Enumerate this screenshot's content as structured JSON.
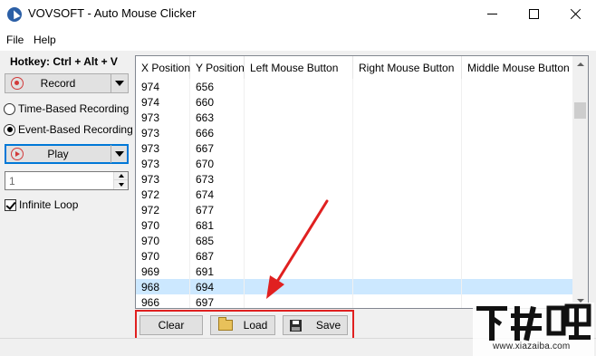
{
  "window": {
    "title": "VOVSOFT - Auto Mouse Clicker",
    "icon": "app-cursor-icon"
  },
  "menu": {
    "file": "File",
    "help": "Help"
  },
  "left_panel": {
    "hotkey": "Hotkey: Ctrl + Alt + V",
    "record_label": "Record",
    "time_based_label": "Time-Based Recording",
    "event_based_label": "Event-Based Recording",
    "selected_mode": "Event-Based Recording",
    "play_label": "Play",
    "repeat_count": "1",
    "infinite_loop_label": "Infinite Loop",
    "infinite_loop_checked": true
  },
  "table": {
    "columns": [
      "X Position",
      "Y Position",
      "Left Mouse Button",
      "Right Mouse Button",
      "Middle Mouse Button"
    ],
    "rows": [
      [
        "974",
        "656",
        "",
        "",
        ""
      ],
      [
        "974",
        "660",
        "",
        "",
        ""
      ],
      [
        "973",
        "663",
        "",
        "",
        ""
      ],
      [
        "973",
        "666",
        "",
        "",
        ""
      ],
      [
        "973",
        "667",
        "",
        "",
        ""
      ],
      [
        "973",
        "670",
        "",
        "",
        ""
      ],
      [
        "973",
        "673",
        "",
        "",
        ""
      ],
      [
        "972",
        "674",
        "",
        "",
        ""
      ],
      [
        "972",
        "677",
        "",
        "",
        ""
      ],
      [
        "970",
        "681",
        "",
        "",
        ""
      ],
      [
        "970",
        "685",
        "",
        "",
        ""
      ],
      [
        "970",
        "687",
        "",
        "",
        ""
      ],
      [
        "969",
        "691",
        "",
        "",
        ""
      ],
      [
        "968",
        "694",
        "",
        "",
        ""
      ],
      [
        "966",
        "697",
        "",
        "",
        ""
      ]
    ],
    "selected_row_index": 13
  },
  "bottom_buttons": {
    "clear": "Clear",
    "load": "Load",
    "save": "Save"
  },
  "watermark": {
    "logo_text": "下载吧",
    "url": "www.xiazaiba.com"
  },
  "colors": {
    "selection": "#cce8ff",
    "annotation": "#e02020",
    "focus_border": "#0078d7"
  }
}
